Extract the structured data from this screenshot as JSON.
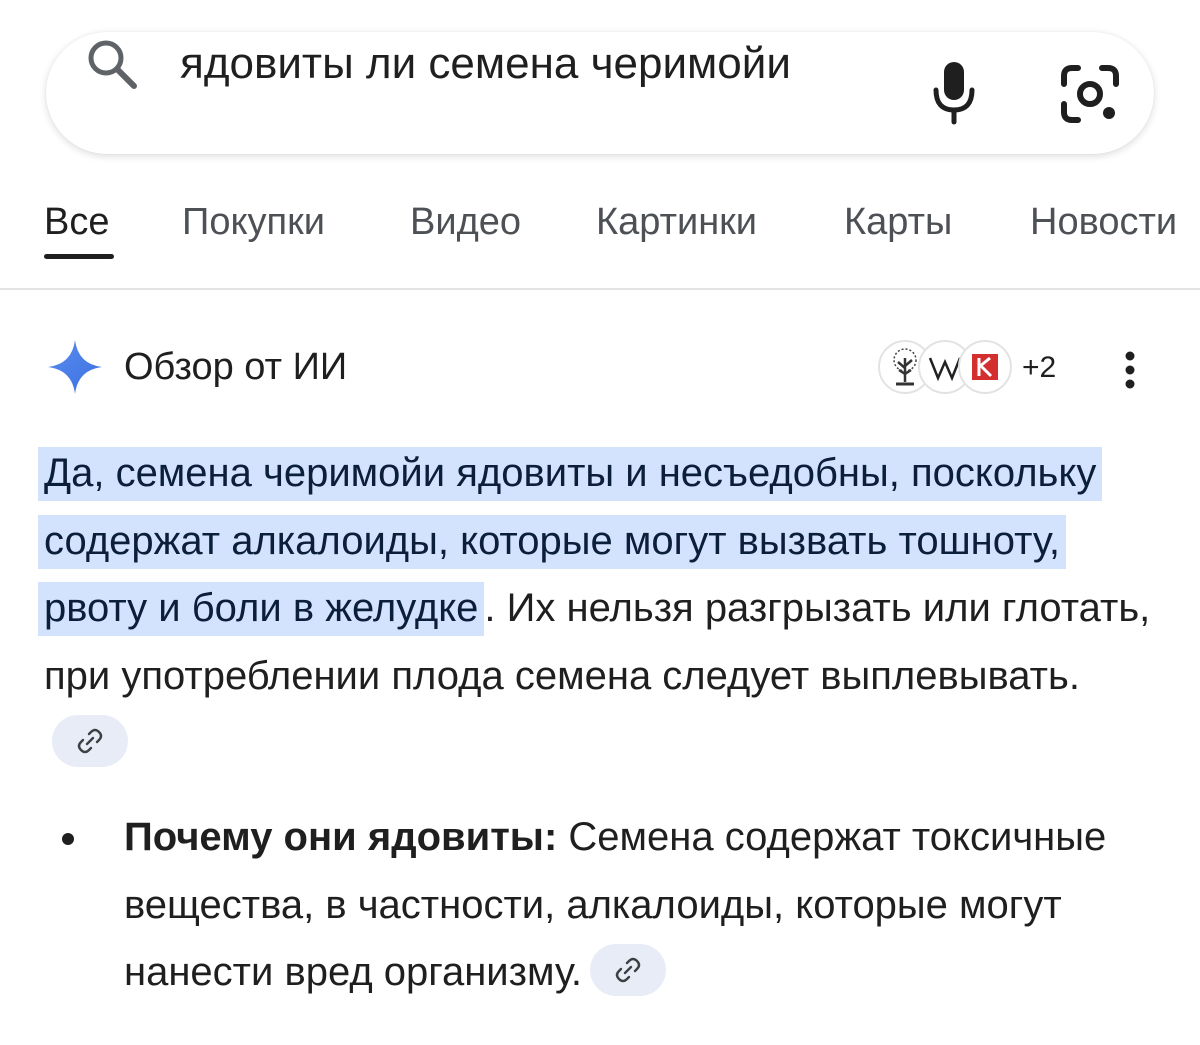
{
  "search": {
    "query": "ядовиты ли семена черимойи"
  },
  "tabs": [
    {
      "label": "Все"
    },
    {
      "label": "Покупки"
    },
    {
      "label": "Видео"
    },
    {
      "label": "Картинки"
    },
    {
      "label": "Карты"
    },
    {
      "label": "Новости"
    }
  ],
  "ai_overview": {
    "title": "Обзор от ИИ",
    "sources_more": "+2",
    "highlight": "Да, семена черимойи ядовиты и несъедобны, поскольку содержат алкалоиды, которые могут вызвать тошноту, рвоту и боли в желудке",
    "rest": ". Их нельзя разгрызать или глотать, при употреблении плода семена следует выплевывать.",
    "bullets": [
      {
        "bold": "Почему они ядовиты:",
        "text": " Семена содержат токсичные вещества, в частности, алкалоиды, которые могут нанести вред организму."
      }
    ]
  },
  "colors": {
    "highlight_bg": "#d3e3fd",
    "sparkle": "#4285f4",
    "chip_bg": "#e8ecf7"
  }
}
